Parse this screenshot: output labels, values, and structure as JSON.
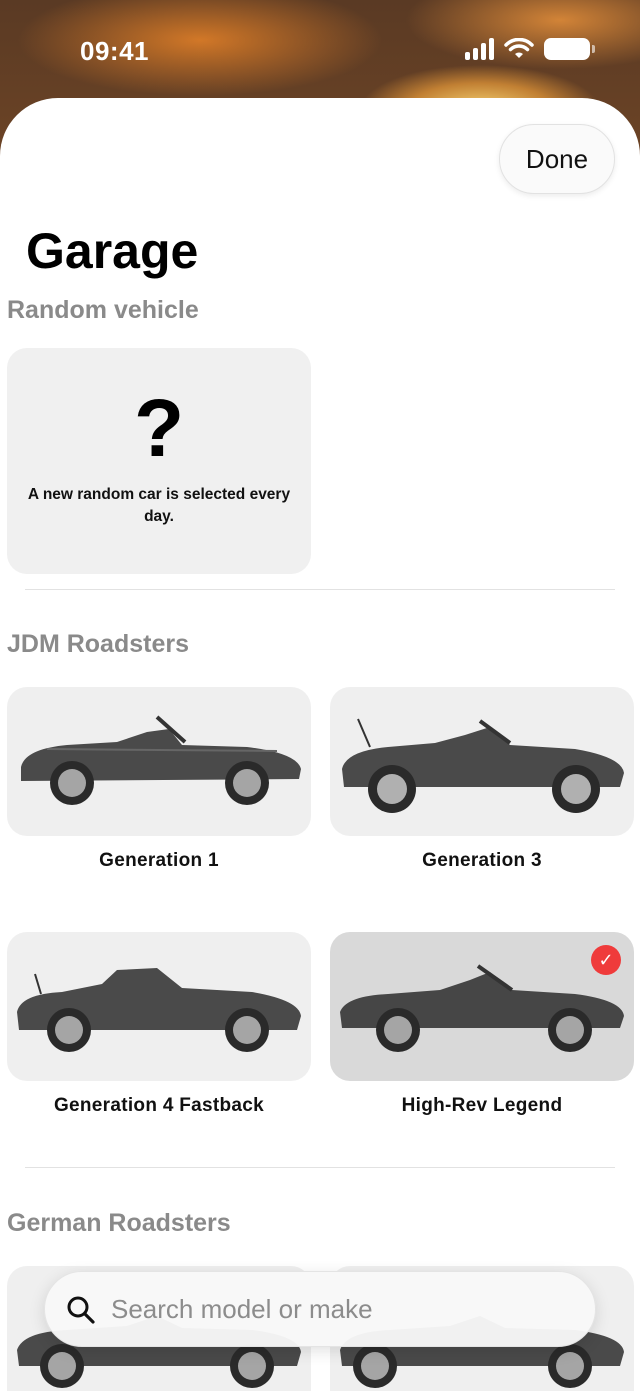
{
  "status_bar": {
    "time": "09:41"
  },
  "sheet": {
    "done_label": "Done",
    "title": "Garage"
  },
  "sections": {
    "random": {
      "header": "Random vehicle",
      "card_symbol": "?",
      "card_text": "A new random car is selected every day."
    },
    "jdm": {
      "header": "JDM Roadsters",
      "items": [
        {
          "label": "Generation 1",
          "selected": false
        },
        {
          "label": "Generation 3",
          "selected": false
        },
        {
          "label": "Generation 4 Fastback",
          "selected": false
        },
        {
          "label": "High-Rev Legend",
          "selected": true
        }
      ]
    },
    "german": {
      "header": "German Roadsters"
    }
  },
  "search": {
    "placeholder": "Search model or make"
  },
  "colors": {
    "accent": "#ef3b3b",
    "card_bg": "#efefef",
    "selected_card_bg": "#d9d9d9",
    "header_gray": "#8a8a8a"
  },
  "icons": {
    "search": "magnifier-icon",
    "check": "checkmark-icon",
    "wifi": "wifi-icon",
    "signal": "cellular-signal-icon",
    "battery": "battery-icon"
  }
}
